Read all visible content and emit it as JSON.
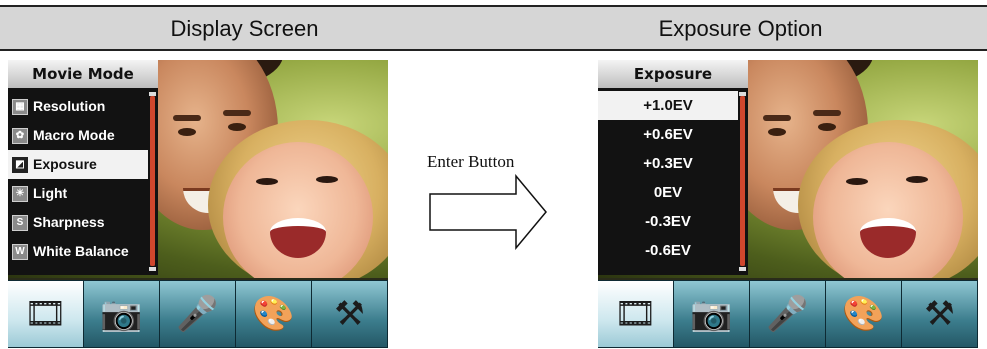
{
  "header": {
    "left_title": "Display Screen",
    "right_title": "Exposure Option"
  },
  "left_screen": {
    "menu_title": "Movie Mode",
    "items": [
      {
        "label": "Resolution",
        "icon": "resolution-icon",
        "glyph": "▦"
      },
      {
        "label": "Macro Mode",
        "icon": "macro-icon",
        "glyph": "✿"
      },
      {
        "label": "Exposure",
        "icon": "exposure-icon",
        "glyph": "◩",
        "selected": true
      },
      {
        "label": "Light",
        "icon": "light-icon",
        "glyph": "☀"
      },
      {
        "label": "Sharpness",
        "icon": "sharpness-icon",
        "glyph": "S"
      },
      {
        "label": "White Balance",
        "icon": "white-balance-icon",
        "glyph": "W"
      }
    ]
  },
  "right_screen": {
    "menu_title": "Exposure",
    "items": [
      {
        "label": "+1.0EV",
        "selected": true
      },
      {
        "label": "+0.6EV"
      },
      {
        "label": "+0.3EV"
      },
      {
        "label": "0EV"
      },
      {
        "label": "-0.3EV"
      },
      {
        "label": "-0.6EV"
      }
    ]
  },
  "toolbar": {
    "buttons": [
      {
        "name": "movie-mode-icon",
        "glyph": "🎞"
      },
      {
        "name": "camera-icon",
        "glyph": "📷"
      },
      {
        "name": "microphone-icon",
        "glyph": "🎤"
      },
      {
        "name": "palette-icon",
        "glyph": "🎨"
      },
      {
        "name": "tools-icon",
        "glyph": "⚒"
      }
    ]
  },
  "arrow": {
    "label": "Enter Button"
  },
  "colors": {
    "accent_scroll": "#d0472d",
    "header_bg": "#d6d6d6",
    "toolbar": "#3c7d8d"
  }
}
